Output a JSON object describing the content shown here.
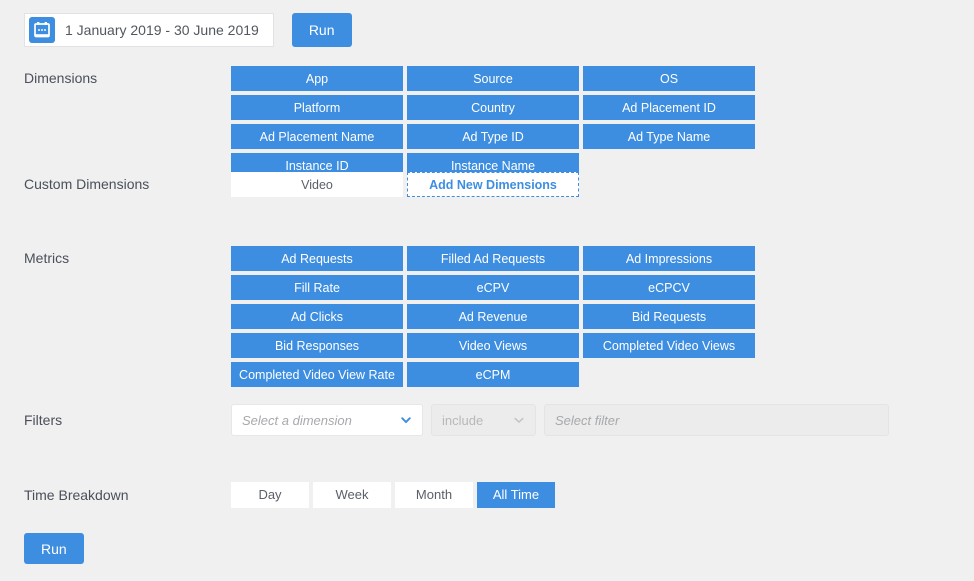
{
  "toolbar": {
    "date_range": "1 January 2019 - 30 June 2019",
    "calendar_icon": "calendar-icon",
    "run_label": "Run"
  },
  "sections": {
    "dimensions": {
      "label": "Dimensions",
      "items": [
        {
          "label": "App",
          "selected": true
        },
        {
          "label": "Source",
          "selected": true
        },
        {
          "label": "OS",
          "selected": true
        },
        {
          "label": "Platform",
          "selected": true
        },
        {
          "label": "Country",
          "selected": true
        },
        {
          "label": "Ad Placement ID",
          "selected": true
        },
        {
          "label": "Ad Placement Name",
          "selected": true
        },
        {
          "label": "Ad Type ID",
          "selected": true
        },
        {
          "label": "Ad Type Name",
          "selected": true
        },
        {
          "label": "Instance ID",
          "selected": true
        },
        {
          "label": "Instance Name",
          "selected": true
        }
      ]
    },
    "custom_dimensions": {
      "label": "Custom Dimensions",
      "items": [
        {
          "label": "Video",
          "selected": false
        }
      ],
      "add_label": "Add New Dimensions"
    },
    "metrics": {
      "label": "Metrics",
      "items": [
        {
          "label": "Ad Requests",
          "selected": true
        },
        {
          "label": "Filled Ad Requests",
          "selected": true
        },
        {
          "label": "Ad Impressions",
          "selected": true
        },
        {
          "label": "Fill Rate",
          "selected": true
        },
        {
          "label": "eCPV",
          "selected": true
        },
        {
          "label": "eCPCV",
          "selected": true
        },
        {
          "label": "Ad Clicks",
          "selected": true
        },
        {
          "label": "Ad Revenue",
          "selected": true
        },
        {
          "label": "Bid Requests",
          "selected": true
        },
        {
          "label": "Bid Responses",
          "selected": true
        },
        {
          "label": "Video Views",
          "selected": true
        },
        {
          "label": "Completed Video Views",
          "selected": true
        },
        {
          "label": "Completed Video View Rate",
          "selected": true
        },
        {
          "label": "eCPM",
          "selected": true
        }
      ]
    },
    "filters": {
      "label": "Filters",
      "dimension_placeholder": "Select a dimension",
      "operator_value": "include",
      "filter_placeholder": "Select filter"
    },
    "time_breakdown": {
      "label": "Time Breakdown",
      "options": [
        {
          "label": "Day",
          "selected": false
        },
        {
          "label": "Week",
          "selected": false
        },
        {
          "label": "Month",
          "selected": false
        },
        {
          "label": "All Time",
          "selected": true
        }
      ]
    }
  },
  "footer": {
    "run_label": "Run"
  },
  "colors": {
    "accent": "#3d8ee0",
    "background": "#f0f0f0",
    "surface": "#ffffff",
    "disabled": "#ececec",
    "label_text": "#4a4f5a"
  }
}
